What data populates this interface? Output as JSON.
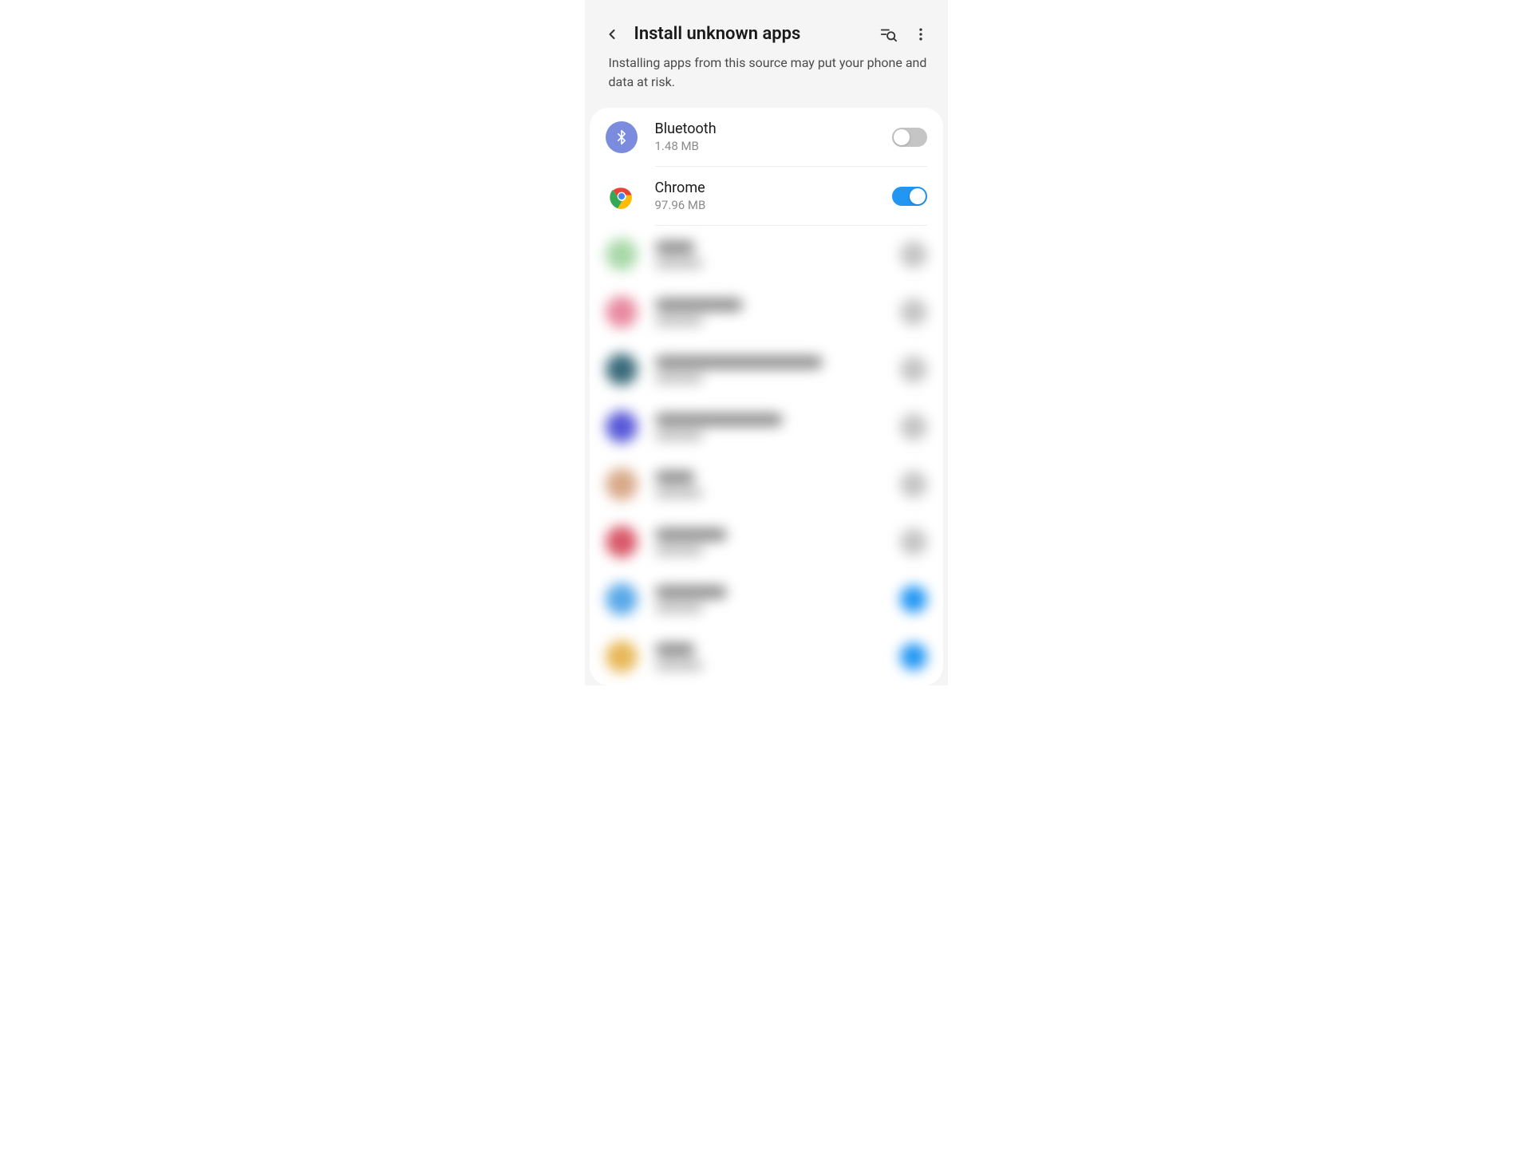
{
  "header": {
    "title": "Install unknown apps"
  },
  "subtitle": "Installing apps from this source may put your phone and data at risk.",
  "apps": [
    {
      "name": "Bluetooth",
      "size": "1.48 MB",
      "enabled": false,
      "icon": "bluetooth-icon"
    },
    {
      "name": "Chrome",
      "size": "97.96 MB",
      "enabled": true,
      "icon": "chrome-icon"
    }
  ],
  "blurred_rows": [
    {
      "iconColor": "#a8d8a8",
      "textWidth": 50,
      "toggleOn": false
    },
    {
      "iconColor": "#e88aa0",
      "textWidth": 110,
      "toggleOn": false
    },
    {
      "iconColor": "#3a6a7a",
      "textWidth": 210,
      "toggleOn": false
    },
    {
      "iconColor": "#5858d8",
      "textWidth": 160,
      "toggleOn": false
    },
    {
      "iconColor": "#d8a888",
      "textWidth": 50,
      "toggleOn": false
    },
    {
      "iconColor": "#d85868",
      "textWidth": 90,
      "toggleOn": false
    },
    {
      "iconColor": "#58a8e8",
      "textWidth": 90,
      "toggleOn": true
    },
    {
      "iconColor": "#e8b858",
      "textWidth": 50,
      "toggleOn": true
    }
  ]
}
